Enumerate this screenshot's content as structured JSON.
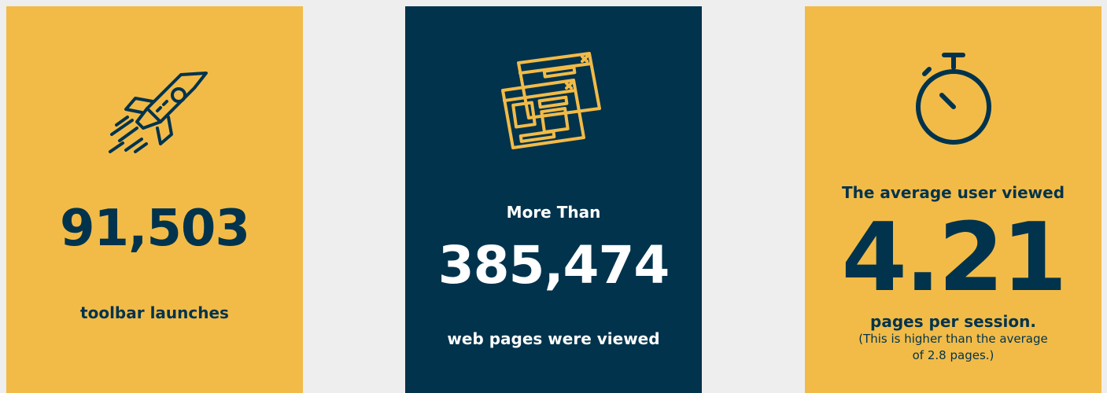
{
  "colors": {
    "background": "#efeeee",
    "yellow": "#f2bb47",
    "navy": "#01334d",
    "white": "#ffffff"
  },
  "cards": [
    {
      "icon": "rocket-icon",
      "value": "91,503",
      "label": "toolbar launches"
    },
    {
      "icon": "browser-windows-icon",
      "prefix": "More Than",
      "value": "385,474",
      "label": "web pages were viewed"
    },
    {
      "icon": "stopwatch-icon",
      "prefix": "The average user viewed",
      "value": "4.21",
      "label": "pages per session.",
      "note_line1": "(This is higher than the average",
      "note_line2": "of 2.8 pages.)"
    }
  ]
}
